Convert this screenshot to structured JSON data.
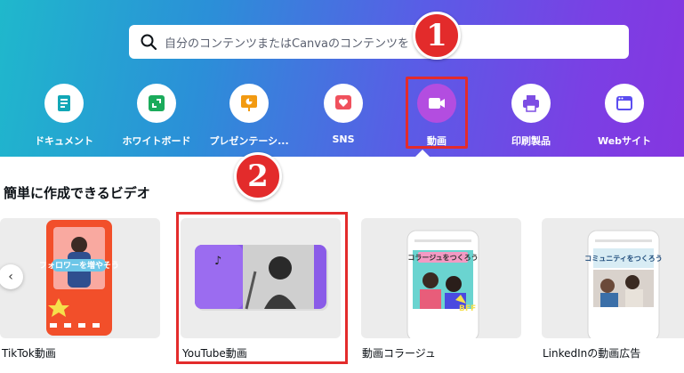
{
  "search": {
    "placeholder": "自分のコンテンツまたはCanvaのコンテンツを"
  },
  "annotations": {
    "step1": "1",
    "step2": "2"
  },
  "categories": [
    {
      "label": "ドキュメント",
      "icon": "document-icon",
      "color": "#12a7b6"
    },
    {
      "label": "ホワイトボード",
      "icon": "whiteboard-icon",
      "color": "#1bab5b"
    },
    {
      "label": "プレゼンテーシ...",
      "icon": "presentation-icon",
      "color": "#f29a11"
    },
    {
      "label": "SNS",
      "icon": "heart-icon",
      "color": "#f0515d"
    },
    {
      "label": "動画",
      "icon": "video-camera-icon",
      "color": "#b34de0"
    },
    {
      "label": "印刷製品",
      "icon": "printer-icon",
      "color": "#7d4de3"
    },
    {
      "label": "Webサイト",
      "icon": "browser-window-icon",
      "color": "#5b4df0"
    }
  ],
  "section": {
    "title": "簡単に作成できるビデオ"
  },
  "templates": [
    {
      "label": "TikTok動画",
      "preview_text": "フォロワーを増やそう"
    },
    {
      "label": "YouTube動画"
    },
    {
      "label": "動画コラージュ",
      "preview_text": "コラージュをつくろう"
    },
    {
      "label": "LinkedInの動画広告",
      "preview_text": "コミュニティをつくろう"
    }
  ],
  "carousel": {
    "prev": "‹"
  },
  "colors": {
    "highlight": "#e32b2b",
    "brand_gradient_start": "#1fb8cc",
    "brand_gradient_end": "#8536e0"
  }
}
